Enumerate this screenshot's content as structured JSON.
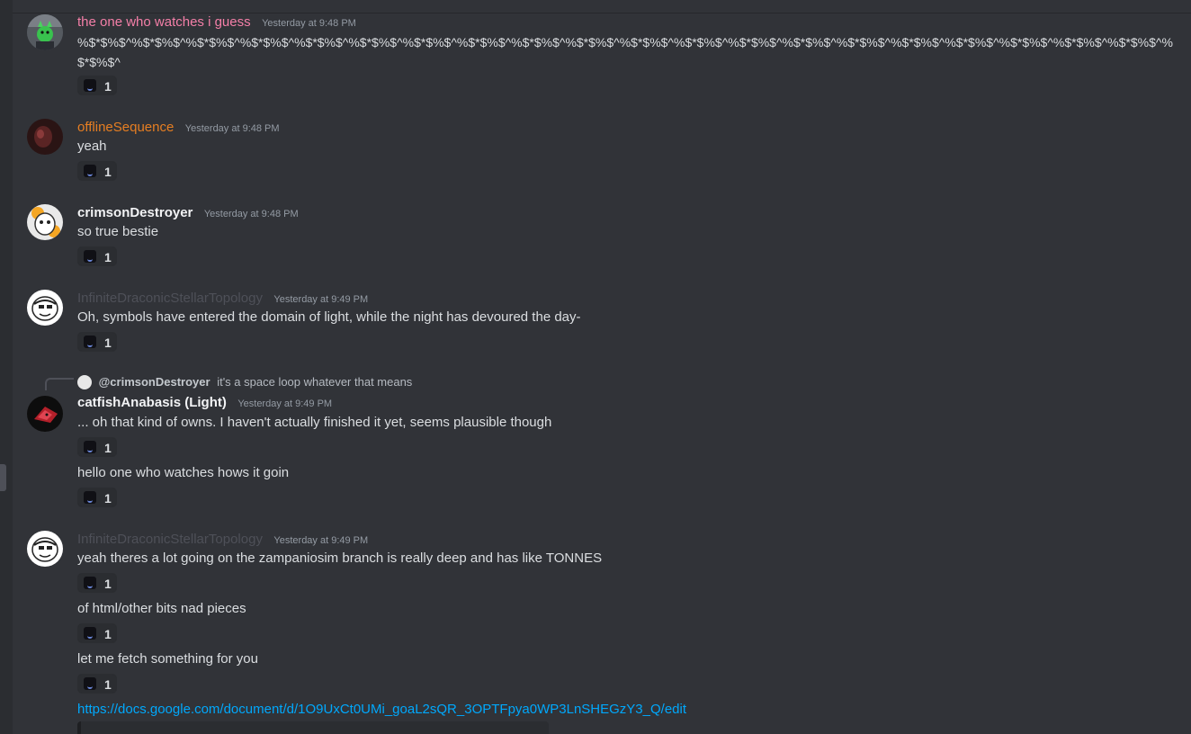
{
  "colors": {
    "background": "#313338",
    "watcher_name": "#f47fa8",
    "offline_name": "#e67e22",
    "white_name": "#f2f3f5",
    "dim_name": "#4e5058",
    "link": "#00a8fc"
  },
  "messages": [
    {
      "username": "the one who watches i guess",
      "timestamp": "Yesterday at 9:48 PM",
      "lines": [
        "%$*$%$^%$*$%$^%$*$%$^%$*$%$^%$*$%$^%$*$%$^%$*$%$^%$*$%$^%$*$%$^%$*$%$^%$*$%$^%$*$%$^%$*$%$^%$*$%$^%$*$%$^%$*$%$^%$*$%$^%$*$%$^%$*$%$^%$*$%$^%$*$%$^"
      ],
      "reactions": [
        "1"
      ]
    },
    {
      "username": "offlineSequence",
      "timestamp": "Yesterday at 9:48 PM",
      "lines": [
        "yeah"
      ],
      "reactions": [
        "1"
      ]
    },
    {
      "username": "crimsonDestroyer",
      "timestamp": "Yesterday at 9:48 PM",
      "lines": [
        "so true bestie"
      ],
      "reactions": [
        "1"
      ]
    },
    {
      "username": "InfiniteDraconicStellarTopology",
      "timestamp": "Yesterday at 9:49 PM",
      "lines": [
        "Oh, symbols have entered the domain of light, while the night has devoured the day-"
      ],
      "reactions": [
        "1"
      ]
    },
    {
      "reply": {
        "user": "@crimsonDestroyer",
        "text": "it's a space loop whatever that means"
      },
      "username": "catfishAnabasis (Light)",
      "timestamp": "Yesterday at 9:49 PM",
      "lines": [
        "... oh that kind of owns. I haven't actually finished it yet, seems plausible though",
        "hello one who watches hows it goin"
      ],
      "reactions": [
        "1",
        "1"
      ]
    },
    {
      "username": "InfiniteDraconicStellarTopology",
      "timestamp": "Yesterday at 9:49 PM",
      "lines": [
        "yeah theres a lot going on the zampaniosim branch is really deep and has like TONNES",
        "of html/other bits nad pieces",
        "let me fetch something for you"
      ],
      "link": "https://docs.google.com/document/d/1O9UxCt0UMi_goaL2sQR_3OPTFpya0WP3LnSHEGzY3_Q/edit",
      "reactions": [
        "1",
        "1",
        "1"
      ]
    }
  ]
}
